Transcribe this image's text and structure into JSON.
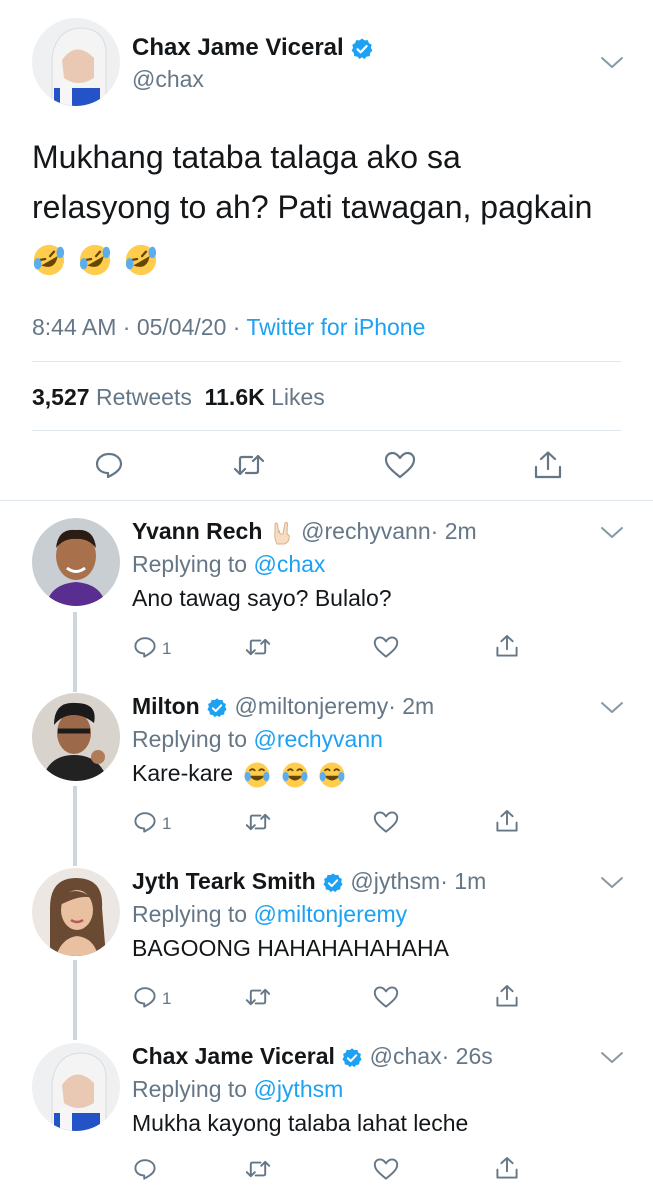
{
  "main_tweet": {
    "name": "Chax Jame Viceral",
    "handle": "@chax",
    "text_line1": "Mukhang tataba talaga ako sa",
    "text_line2": "relasyong to ah? Pati tawagan, pagkain",
    "emojis": [
      "rolling-on-floor-laughing",
      "rolling-on-floor-laughing",
      "rolling-on-floor-laughing"
    ],
    "time": "8:44 AM · 05/04/20 · ",
    "source": "Twitter for iPhone",
    "retweets_count": "3,527",
    "retweets_label": "Retweets",
    "likes_count": "11.6K",
    "likes_label": "Likes"
  },
  "replies": [
    {
      "name": "Yvann Rech",
      "badge": "rock-on-hand-emoji",
      "handle": "@rechyvann",
      "time": "· 2m",
      "replying_prefix": "Replying to ",
      "replying_to": "@chax",
      "text": "Ano tawag sayo? Bulalo?",
      "reply_count": "1"
    },
    {
      "name": "Milton",
      "badge": "verified",
      "handle": "@miltonjeremy",
      "time": "· 2m",
      "replying_prefix": "Replying to ",
      "replying_to": "@rechyvann",
      "text": "Kare-kare",
      "emojis": [
        "face-with-tears-of-joy",
        "face-with-tears-of-joy",
        "face-with-tears-of-joy"
      ],
      "reply_count": "1"
    },
    {
      "name": "Jyth Teark Smith",
      "badge": "verified",
      "handle": "@jythsm",
      "time": "· 1m",
      "replying_prefix": "Replying to ",
      "replying_to": "@miltonjeremy",
      "text": "BAGOONG HAHAHAHAHAHA",
      "reply_count": "1"
    },
    {
      "name": "Chax Jame Viceral",
      "badge": "verified",
      "handle": "@chax",
      "time": "· 26s",
      "replying_prefix": "Replying to ",
      "replying_to": "@jythsm",
      "text": "Mukha kayong talaba lahat leche",
      "reply_count": ""
    }
  ],
  "colors": {
    "accent": "#1da1f2",
    "secondary_text": "#657786",
    "thread_line": "#ccd6dd",
    "divider": "#e1e8ed"
  }
}
